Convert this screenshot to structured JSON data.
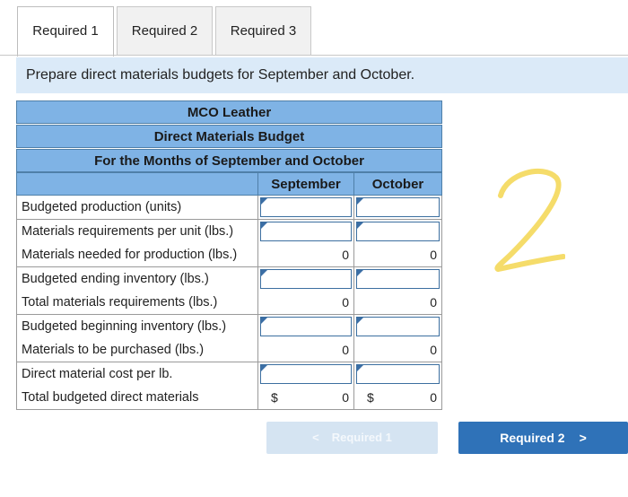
{
  "tabs": [
    {
      "label": "Required 1",
      "active": true
    },
    {
      "label": "Required 2",
      "active": false
    },
    {
      "label": "Required 3",
      "active": false
    }
  ],
  "instruction": "Prepare direct materials budgets for September and October.",
  "table": {
    "company": "MCO Leather",
    "title": "Direct Materials Budget",
    "period": "For the Months of September and October",
    "columns": [
      "September",
      "October"
    ],
    "rows": [
      {
        "label": "Budgeted production (units)",
        "values": [
          "",
          ""
        ],
        "editable": true
      },
      {
        "label": "Materials requirements per unit (lbs.)",
        "values": [
          "",
          ""
        ],
        "editable": true
      },
      {
        "label": "Materials needed for production (lbs.)",
        "values": [
          "0",
          "0"
        ],
        "editable": false
      },
      {
        "label": "Budgeted ending inventory (lbs.)",
        "values": [
          "",
          ""
        ],
        "editable": true
      },
      {
        "label": "Total materials requirements (lbs.)",
        "values": [
          "0",
          "0"
        ],
        "editable": false
      },
      {
        "label": "Budgeted beginning inventory (lbs.)",
        "values": [
          "",
          ""
        ],
        "editable": true
      },
      {
        "label": "Materials to be purchased (lbs.)",
        "values": [
          "0",
          "0"
        ],
        "editable": false
      },
      {
        "label": "Direct material cost per lb.",
        "values": [
          "",
          ""
        ],
        "editable": true
      },
      {
        "label": "Total budgeted direct materials",
        "values": [
          "0",
          "0"
        ],
        "editable": false,
        "currency": "$"
      }
    ]
  },
  "nav": {
    "prev_label": "Required 1",
    "next_label": "Required 2",
    "prev_icon": "chevron-left-icon",
    "next_icon": "chevron-right-icon",
    "prev_glyph": "<",
    "next_glyph": ">"
  },
  "colors": {
    "header_blue": "#7fb3e5",
    "button_blue": "#2f72b8",
    "scribble_yellow": "#f5dc6a"
  }
}
